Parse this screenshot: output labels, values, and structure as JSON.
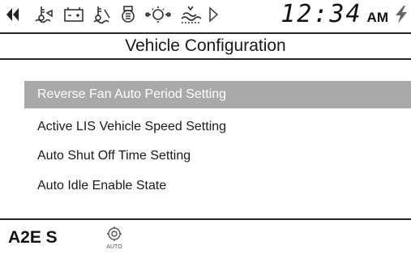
{
  "status_bar": {
    "icons": [
      "scroll-left-icon",
      "hydraulic-oil-temp-icon",
      "battery-charge-icon",
      "coolant-level-icon",
      "air-filter-icon",
      "engine-oil-pressure-icon",
      "water-in-fuel-icon",
      "scroll-right-icon"
    ],
    "clock_time": "12:34",
    "clock_ampm": "AM",
    "power_icon": "lightning-icon"
  },
  "title": "Vehicle Configuration",
  "menu": {
    "items": [
      {
        "label": "Reverse Fan Auto Period Setting",
        "selected": true
      },
      {
        "label": "Active LIS Vehicle Speed Setting",
        "selected": false
      },
      {
        "label": "Auto Shut Off Time Setting",
        "selected": false
      },
      {
        "label": "Auto Idle Enable State",
        "selected": false
      }
    ]
  },
  "footer": {
    "model": "A2E S",
    "auto_label": "AUTO",
    "auto_icon": "auto-idle-icon"
  },
  "colors": {
    "selected_bg": "#a9a9a9",
    "selected_text": "#ffffff",
    "text": "#1a1a1a",
    "rule": "#2a2a2a"
  }
}
